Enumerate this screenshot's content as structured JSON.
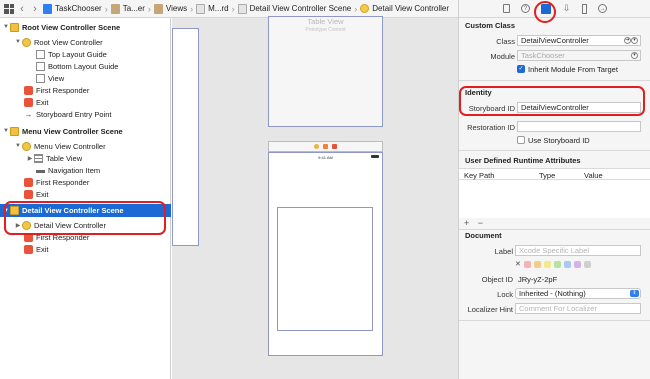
{
  "jumpbar": {
    "items": [
      "TaskChooser",
      "Ta...er",
      "Views",
      "M...rd",
      "Detail View Controller Scene",
      "Detail View Controller"
    ]
  },
  "outline": {
    "rows": [
      {
        "label": "Root View Controller Scene"
      },
      {
        "label": "Root View Controller"
      },
      {
        "label": "Top Layout Guide"
      },
      {
        "label": "Bottom Layout Guide"
      },
      {
        "label": "View"
      },
      {
        "label": "First Responder"
      },
      {
        "label": "Exit"
      },
      {
        "label": "Storyboard Entry Point"
      },
      {
        "label": "Menu View Controller Scene"
      },
      {
        "label": "Menu View Controller"
      },
      {
        "label": "Table View"
      },
      {
        "label": "Navigation Item"
      },
      {
        "label": "First Responder"
      },
      {
        "label": "Exit"
      },
      {
        "label": "Detail View Controller Scene"
      },
      {
        "label": "Detail View Controller"
      },
      {
        "label": "First Responder"
      },
      {
        "label": "Exit"
      }
    ]
  },
  "canvas": {
    "table_view_title": "Table View",
    "table_view_subtitle": "Prototype Content",
    "status_time": "9:41 AM"
  },
  "inspector": {
    "custom_class": {
      "header": "Custom Class",
      "class_label": "Class",
      "class_value": "DetailViewController",
      "module_label": "Module",
      "module_value": "TaskChooser",
      "inherit_label": "Inherit Module From Target"
    },
    "identity": {
      "header": "Identity",
      "storyboard_id_label": "Storyboard ID",
      "storyboard_id_value": "DetailViewController",
      "restoration_id_label": "Restoration ID",
      "restoration_id_value": "",
      "use_storyboard_id_label": "Use Storyboard ID"
    },
    "runtime_attrs": {
      "header": "User Defined Runtime Attributes",
      "col_key_path": "Key Path",
      "col_type": "Type",
      "col_value": "Value",
      "add_remove": "+ −"
    },
    "document": {
      "header": "Document",
      "label_label": "Label",
      "label_placeholder": "Xcode Specific Label",
      "object_id_label": "Object ID",
      "object_id_value": "JRy-yZ-2pF",
      "lock_label": "Lock",
      "lock_value": "Inherited - (Nothing)",
      "localizer_hint_label": "Localizer Hint",
      "localizer_hint_placeholder": "Comment For Localizer",
      "swatch_colors": [
        "#f2b4b4",
        "#f4cc88",
        "#f3ea8c",
        "#b6e3a2",
        "#a9c8f2",
        "#d5b3ea",
        "#cfcfcf"
      ]
    }
  }
}
